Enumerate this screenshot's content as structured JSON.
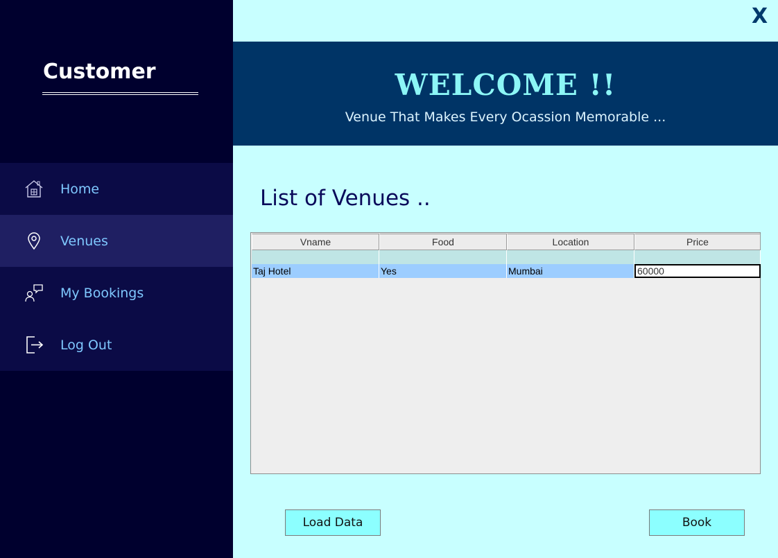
{
  "window": {
    "close_label": "X"
  },
  "sidebar": {
    "brand": "Customer",
    "items": [
      {
        "label": "Home",
        "icon": "home-icon",
        "active": false
      },
      {
        "label": "Venues",
        "icon": "location-pin-icon",
        "active": true
      },
      {
        "label": "My Bookings",
        "icon": "user-chat-icon",
        "active": false
      },
      {
        "label": "Log Out",
        "icon": "logout-icon",
        "active": false
      }
    ]
  },
  "header": {
    "title": "WELCOME !!",
    "tagline": "Venue That Makes Every Ocassion Memorable ..."
  },
  "main": {
    "title": "List of Venues ..",
    "table": {
      "columns": [
        "Vname",
        "Food",
        "Location",
        "Price"
      ],
      "rows": [
        [
          "",
          "",
          "",
          ""
        ],
        [
          "Taj Hotel",
          "Yes",
          "Mumbai",
          "60000"
        ]
      ]
    },
    "buttons": {
      "load": "Load Data",
      "book": "Book"
    }
  },
  "colors": {
    "sidebar_bg": "#00002e",
    "nav_bg": "#0b0b46",
    "nav_active_bg": "#1f1f62",
    "header_bg": "#003466",
    "page_bg": "#c8ffff",
    "accent_text": "#8cf6f6",
    "button_bg": "#8cffff",
    "selected_row": "#9ccdff"
  }
}
